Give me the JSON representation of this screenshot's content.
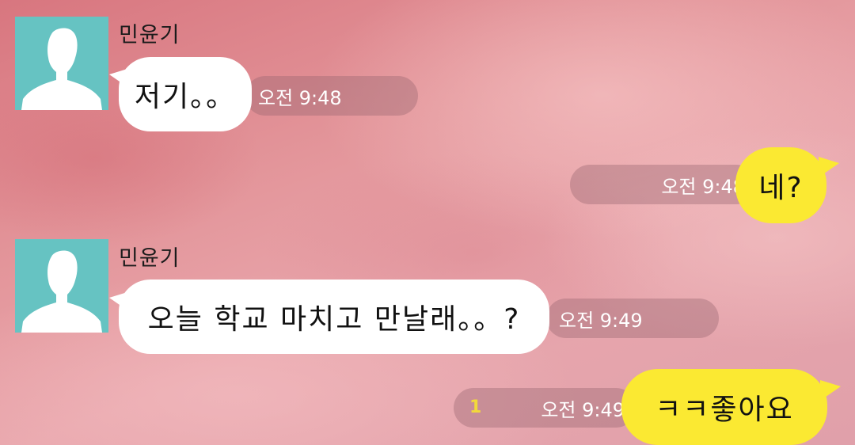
{
  "messages": [
    {
      "direction": "incoming",
      "sender": "민윤기",
      "text": "저기。。",
      "time": "오전 9:48"
    },
    {
      "direction": "outgoing",
      "text": "네?",
      "time": "오전 9:48"
    },
    {
      "direction": "incoming",
      "sender": "민윤기",
      "text": "오늘 학교 마치고 만날래。。?",
      "time": "오전 9:49"
    },
    {
      "direction": "outgoing",
      "text": "ㅋㅋ좋아요",
      "time": "오전 9:49",
      "unread_count": "1"
    }
  ],
  "colors": {
    "incoming_bubble": "#ffffff",
    "outgoing_bubble": "#fbe932",
    "avatar_bg": "#66c3c2",
    "unread": "#f2d93a"
  },
  "icons": {
    "avatar": "default-profile-person-icon"
  }
}
